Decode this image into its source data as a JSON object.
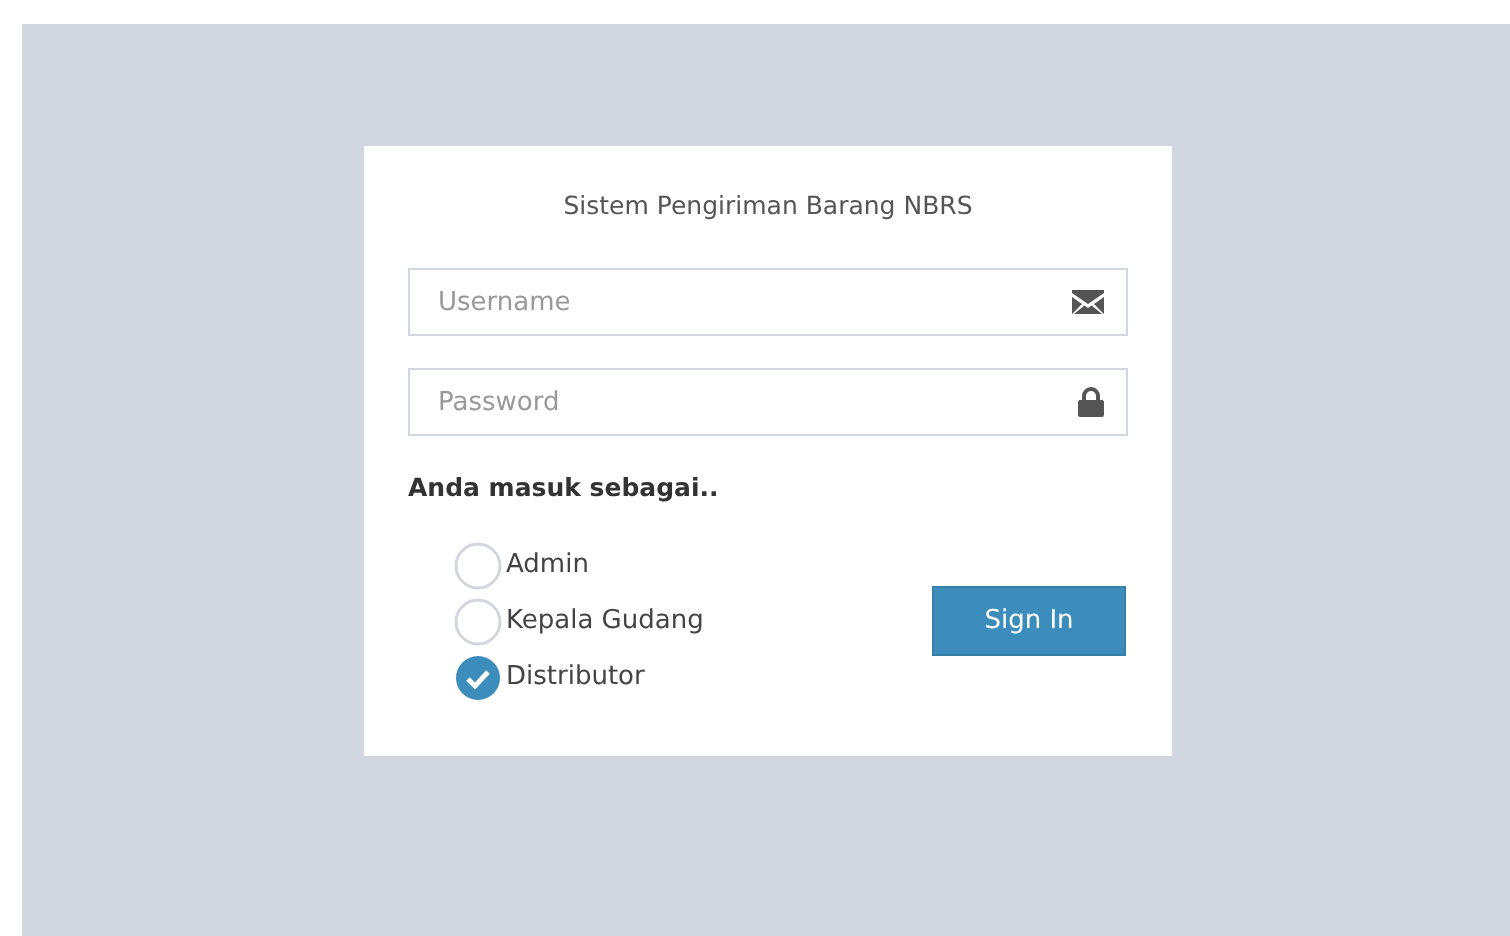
{
  "login_box": {
    "title": "Sistem Pengiriman Barang NBRS",
    "fields": [
      {
        "placeholder": "Username",
        "kind": "email"
      },
      {
        "placeholder": "Password",
        "kind": "password"
      }
    ],
    "role_label": "Anda masuk sebagai..",
    "roles": [
      {
        "label": "Admin",
        "selected": false
      },
      {
        "label": "Kepala Gudang",
        "selected": false
      },
      {
        "label": "Distributor",
        "selected": true
      }
    ],
    "button": "Sign In"
  }
}
